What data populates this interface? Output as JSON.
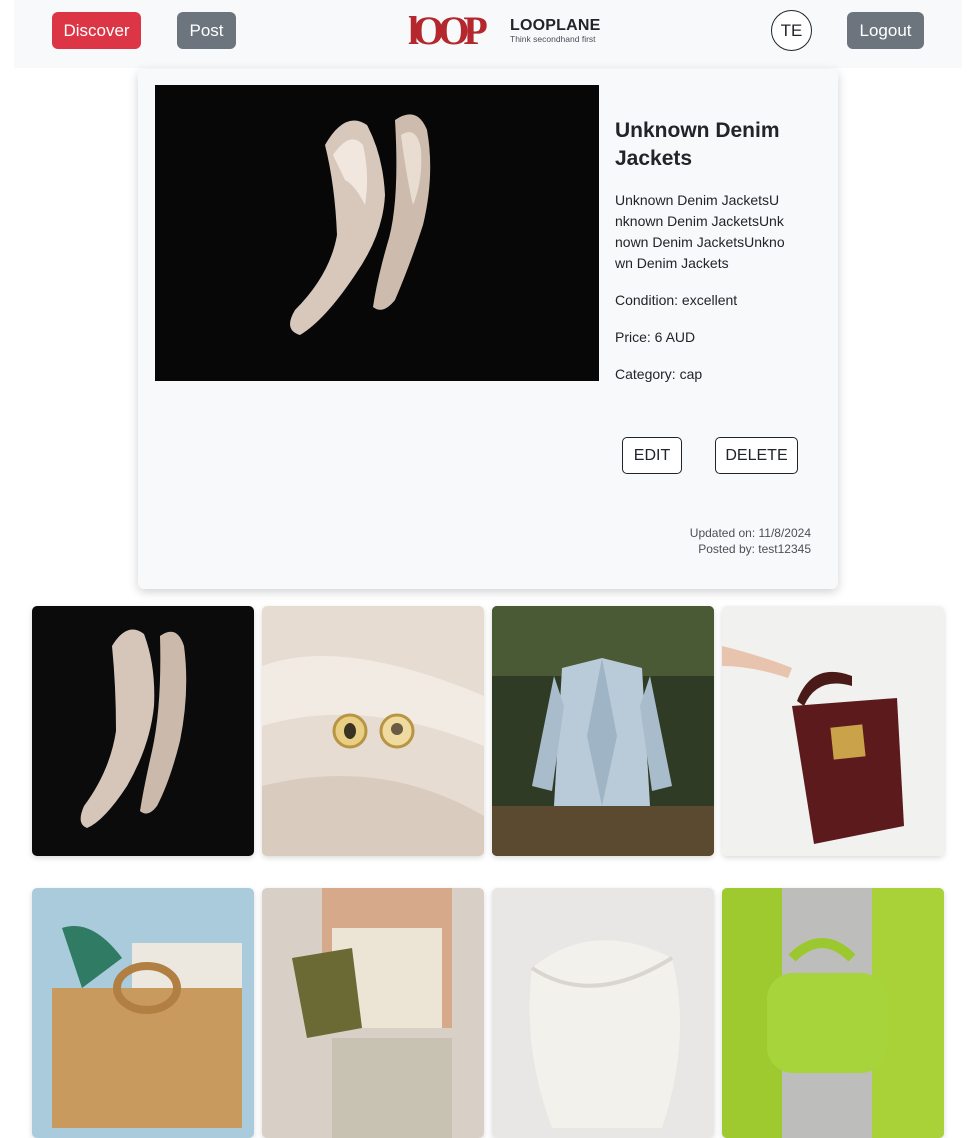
{
  "nav": {
    "discover_label": "Discover",
    "post_label": "Post",
    "logo_mark": "lOOP",
    "logo_name": "LOOPLANE",
    "logo_tagline": "Think secondhand first",
    "avatar_initials": "TE",
    "logout_label": "Logout"
  },
  "listing": {
    "title": "Unknown Denim Jackets",
    "description": "Unknown Denim JacketsUnknown Denim JacketsUnknown Denim JacketsUnknown Denim Jackets",
    "condition": "Condition: excellent",
    "price": "Price: 6 AUD",
    "category": "Category: cap",
    "edit_label": "EDIT",
    "delete_label": "DELETE",
    "updated": "Updated on: 11/8/2024",
    "posted_by": "Posted by: test12345",
    "photo": "cream-pumps-on-black"
  },
  "grid": [
    {
      "photo": "cream-pumps-on-black"
    },
    {
      "photo": "gold-coin-earrings"
    },
    {
      "photo": "light-blue-blazer-hanging"
    },
    {
      "photo": "burgundy-croc-handbag"
    },
    {
      "photo": "straw-tote-basket"
    },
    {
      "photo": "olive-shoulder-bag-outfit"
    },
    {
      "photo": "white-knit-sweater"
    },
    {
      "photo": "lime-puffer-bag"
    }
  ],
  "colors": {
    "brand_red": "#b3272d",
    "danger": "#dc3545",
    "secondary": "#6c757d",
    "nav_bg": "#f8f9fa"
  }
}
